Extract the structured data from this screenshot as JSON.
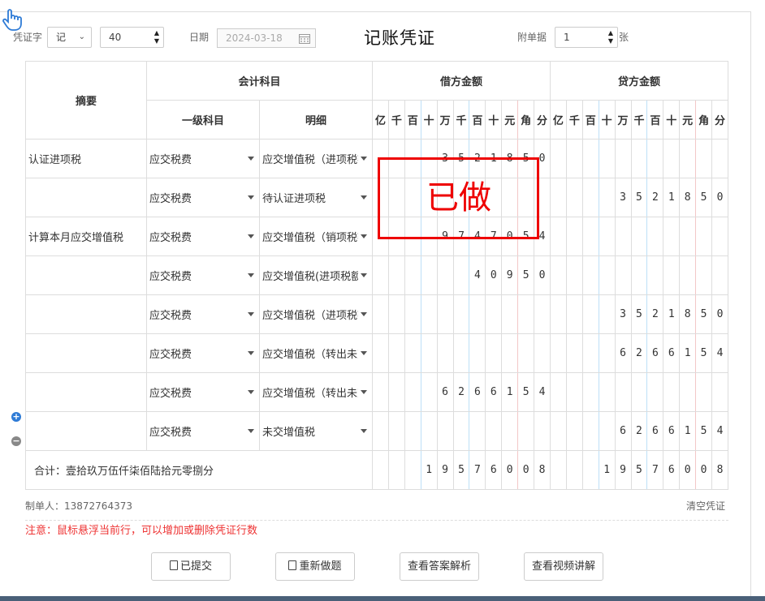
{
  "header": {
    "voucher_word_label": "凭证字",
    "voucher_word_value": "记",
    "voucher_number": "40",
    "date_label": "日期",
    "date_value": "2024-03-18",
    "title": "记账凭证",
    "attachment_label": "附单据",
    "attachment_count": "1",
    "attachment_unit": "张"
  },
  "columns": {
    "summary": "摘要",
    "account": "会计科目",
    "account_level1": "一级科目",
    "account_detail": "明细",
    "debit": "借方金额",
    "credit": "贷方金额",
    "digits": [
      "亿",
      "千",
      "百",
      "十",
      "万",
      "千",
      "百",
      "十",
      "元",
      "角",
      "分"
    ]
  },
  "rows": [
    {
      "summary": "认证进项税",
      "level1": "应交税费",
      "detail": "应交增值税（进项税额）",
      "debit": "3521850",
      "credit": ""
    },
    {
      "summary": "",
      "level1": "应交税费",
      "detail": "待认证进项税",
      "debit": "",
      "credit": "3521850"
    },
    {
      "summary": "计算本月应交增值税",
      "level1": "应交税费",
      "detail": "应交增值税（销项税额）",
      "debit": "9747054",
      "credit": ""
    },
    {
      "summary": "",
      "level1": "应交税费",
      "detail": "应交增值税(进项税额转出)",
      "debit": "40950",
      "credit": ""
    },
    {
      "summary": "",
      "level1": "应交税费",
      "detail": "应交增值税（进项税额）",
      "debit": "",
      "credit": "3521850"
    },
    {
      "summary": "",
      "level1": "应交税费",
      "detail": "应交增值税（转出未交增值税）",
      "debit": "",
      "credit": "6266154"
    },
    {
      "summary": "",
      "level1": "应交税费",
      "detail": "应交增值税（转出未交增值税）",
      "debit": "6266154",
      "credit": ""
    },
    {
      "summary": "",
      "level1": "应交税费",
      "detail": "未交增值税",
      "debit": "",
      "credit": "6266154"
    }
  ],
  "total": {
    "label": "合计：壹拾玖万伍仟柒佰陆拾元零捌分",
    "debit": "19576008",
    "credit": "19576008"
  },
  "stamp_text": "已做",
  "footer": {
    "maker": "制单人：13872764373",
    "clear": "清空凭证",
    "note": "注意：鼠标悬浮当前行，可以增加或删除凭证行数"
  },
  "buttons": {
    "submitted": "已提交",
    "redo": "重新做题",
    "view_answer": "查看答案解析",
    "view_video": "查看视频讲解"
  },
  "colors": {
    "stamp": "#e00000",
    "note": "#e33333",
    "add": "#2e7bd6"
  }
}
